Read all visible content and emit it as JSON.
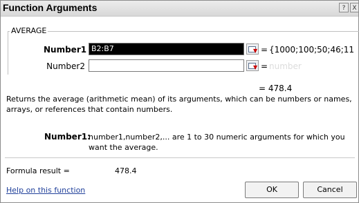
{
  "window": {
    "title": "Function Arguments",
    "help_btn": "?",
    "close_btn": "X"
  },
  "function_name": "AVERAGE",
  "args": [
    {
      "label": "Number1",
      "value": "B2:B7",
      "equals": "=",
      "preview": "{1000;100;50;46;11"
    },
    {
      "label": "Number2",
      "value": "",
      "equals": "=",
      "preview": "number"
    }
  ],
  "result_preview": "= 478.4",
  "description": "Returns the average (arithmetic mean) of its arguments, which can be numbers or names, arrays, or references that contain numbers.",
  "arg_help": {
    "label": "Number1:",
    "text": "number1,number2,... are 1 to 30 numeric arguments for which you want the average."
  },
  "formula_result": {
    "label": "Formula result =",
    "value": "478.4"
  },
  "help_link": "Help on this function",
  "buttons": {
    "ok": "OK",
    "cancel": "Cancel"
  }
}
